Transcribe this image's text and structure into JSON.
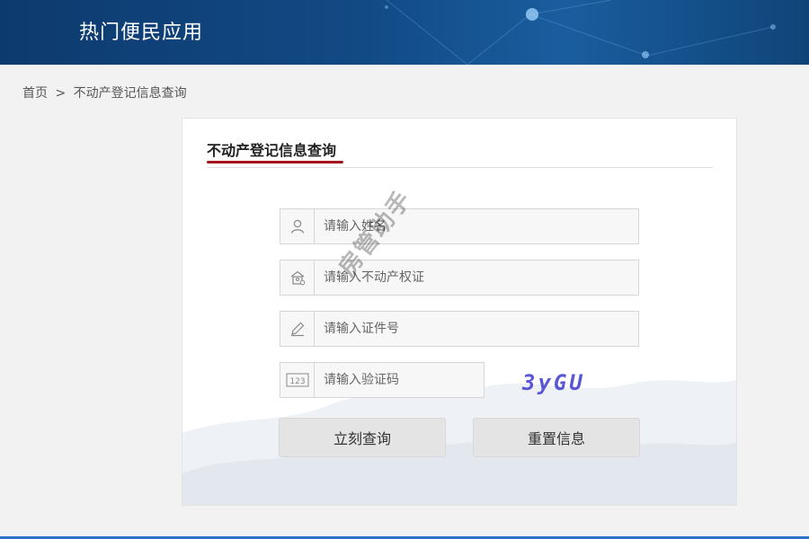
{
  "header": {
    "title": "热门便民应用"
  },
  "breadcrumb": {
    "home": "首页",
    "separator": ">",
    "current": "不动产登记信息查询"
  },
  "card": {
    "title": "不动产登记信息查询",
    "fields": {
      "name": {
        "placeholder": "请输入姓名",
        "icon": "user-icon"
      },
      "cert": {
        "placeholder": "请输入不动产权证",
        "icon": "house-icon"
      },
      "id": {
        "placeholder": "请输入证件号",
        "icon": "pencil-icon"
      },
      "captcha": {
        "placeholder": "请输入验证码",
        "icon": "123-icon"
      }
    },
    "captcha_text": "3yGU",
    "buttons": {
      "query": "立刻查询",
      "reset": "重置信息"
    }
  },
  "watermark": "房管助手",
  "colors": {
    "header": "#124a85",
    "accent_underline": "#a3141d",
    "captcha": "#5a56d6",
    "bottom_bar": "#2a73c8"
  }
}
